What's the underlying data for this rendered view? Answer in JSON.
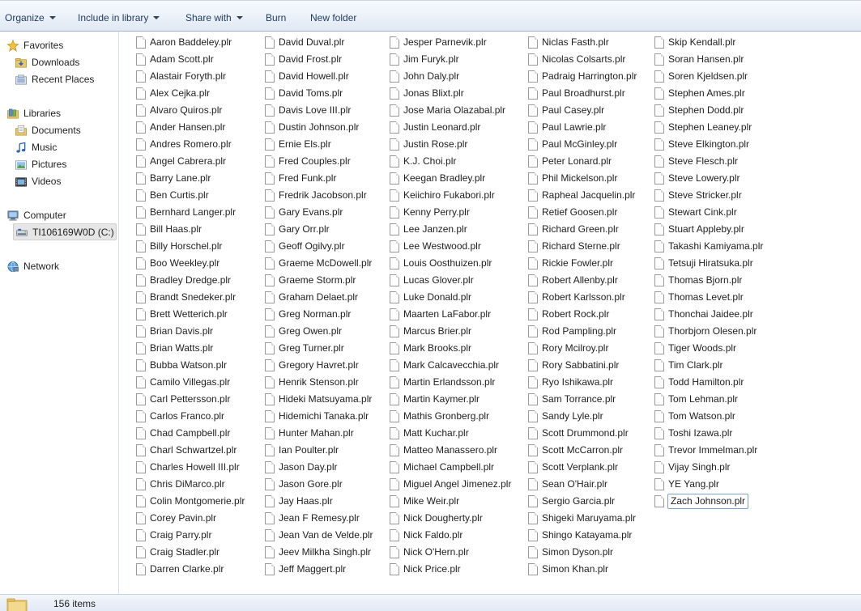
{
  "toolbar": {
    "organize": "Organize",
    "include_in_library": "Include in library",
    "share_with": "Share with",
    "burn": "Burn",
    "new_folder": "New folder"
  },
  "nav": {
    "favorites": "Favorites",
    "downloads": "Downloads",
    "recent_places": "Recent Places",
    "libraries": "Libraries",
    "documents": "Documents",
    "music": "Music",
    "pictures": "Pictures",
    "videos": "Videos",
    "computer": "Computer",
    "drive": "TI106169W0D (C:)",
    "network": "Network"
  },
  "files": {
    "columns": [
      [
        "Aaron Baddeley.plr",
        "Adam Scott.plr",
        "Alastair Foryth.plr",
        "Alex Cejka.plr",
        "Alvaro Quiros.plr",
        "Ander Hansen.plr",
        "Andres Romero.plr",
        "Angel Cabrera.plr",
        "Barry Lane.plr",
        "Ben Curtis.plr",
        "Bernhard Langer.plr",
        "Bill Haas.plr",
        "Billy Horschel.plr",
        "Boo Weekley.plr",
        "Bradley Dredge.plr",
        "Brandt Snedeker.plr",
        "Brett Wetterich.plr",
        "Brian Davis.plr",
        "Brian Watts.plr",
        "Bubba Watson.plr",
        "Camilo Villegas.plr",
        "Carl Pettersson.plr",
        "Carlos Franco.plr",
        "Chad Campbell.plr",
        "Charl Schwartzel.plr",
        "Charles Howell III.plr",
        "Chris DiMarco.plr",
        "Colin Montgomerie.plr",
        "Corey Pavin.plr",
        "Craig Parry.plr",
        "Craig Stadler.plr",
        "Darren Clarke.plr"
      ],
      [
        "David Duval.plr",
        "David Frost.plr",
        "David Howell.plr",
        "David Toms.plr",
        "Davis Love III.plr",
        "Dustin Johnson.plr",
        "Ernie Els.plr",
        "Fred Couples.plr",
        "Fred Funk.plr",
        "Fredrik Jacobson.plr",
        "Gary Evans.plr",
        "Gary Orr.plr",
        "Geoff Ogilvy.plr",
        "Graeme McDowell.plr",
        "Graeme Storm.plr",
        "Graham Delaet.plr",
        "Greg Norman.plr",
        "Greg Owen.plr",
        "Greg Turner.plr",
        "Gregory Havret.plr",
        "Henrik Stenson.plr",
        "Hideki Matsuyama.plr",
        "Hidemichi Tanaka.plr",
        "Hunter Mahan.plr",
        "Ian Poulter.plr",
        "Jason  Day.plr",
        "Jason Gore.plr",
        "Jay Haas.plr",
        "Jean F Remesy.plr",
        "Jean Van de Velde.plr",
        "Jeev Milkha Singh.plr",
        "Jeff Maggert.plr"
      ],
      [
        "Jesper Parnevik.plr",
        "Jim Furyk.plr",
        "John Daly.plr",
        "Jonas Blixt.plr",
        "Jose Maria Olazabal.plr",
        "Justin Leonard.plr",
        "Justin Rose.plr",
        "K.J. Choi.plr",
        "Keegan Bradley.plr",
        "Keiichiro Fukabori.plr",
        "Kenny Perry.plr",
        "Lee Janzen.plr",
        "Lee Westwood.plr",
        "Louis Oosthuizen.plr",
        "Lucas Glover.plr",
        "Luke Donald.plr",
        "Maarten LaFabor.plr",
        "Marcus Brier.plr",
        "Mark Brooks.plr",
        "Mark Calcavecchia.plr",
        "Martin Erlandsson.plr",
        "Martin Kaymer.plr",
        "Mathis Gronberg.plr",
        "Matt Kuchar.plr",
        "Matteo Manassero.plr",
        "Michael Campbell.plr",
        "Miguel Angel Jimenez.plr",
        "Mike Weir.plr",
        "Nick Dougherty.plr",
        "Nick Faldo.plr",
        "Nick O'Hern.plr",
        "Nick Price.plr"
      ],
      [
        "Niclas Fasth.plr",
        "Nicolas Colsarts.plr",
        "Padraig Harrington.plr",
        "Paul Broadhurst.plr",
        "Paul Casey.plr",
        "Paul Lawrie.plr",
        "Paul McGinley.plr",
        "Peter Lonard.plr",
        "Phil Mickelson.plr",
        "Rapheal Jacquelin.plr",
        "Retief Goosen.plr",
        "Richard Green.plr",
        "Richard Sterne.plr",
        "Rickie Fowler.plr",
        "Robert Allenby.plr",
        "Robert Karlsson.plr",
        "Robert Rock.plr",
        "Rod Pampling.plr",
        "Rory Mcilroy.plr",
        "Rory Sabbatini.plr",
        "Ryo Ishikawa.plr",
        "Sam Torrance.plr",
        "Sandy Lyle.plr",
        "Scott Drummond.plr",
        "Scott McCarron.plr",
        "Scott Verplank.plr",
        "Sean O'Hair.plr",
        "Sergio Garcia.plr",
        "Shigeki Maruyama.plr",
        "Shingo Katayama.plr",
        "Simon Dyson.plr",
        "Simon Khan.plr"
      ],
      [
        "Skip Kendall.plr",
        "Soran Hansen.plr",
        "Soren Kjeldsen.plr",
        "Stephen Ames.plr",
        "Stephen Dodd.plr",
        "Stephen Leaney.plr",
        "Steve Elkington.plr",
        "Steve Flesch.plr",
        "Steve Lowery.plr",
        "Steve Stricker.plr",
        "Stewart Cink.plr",
        "Stuart Appleby.plr",
        "Takashi Kamiyama.plr",
        "Tetsuji Hiratsuka.plr",
        "Thomas Bjorn.plr",
        "Thomas Levet.plr",
        "Thonchai Jaidee.plr",
        "Thorbjorn Olesen.plr",
        "Tiger Woods.plr",
        "Tim Clark.plr",
        "Todd Hamilton.plr",
        "Tom Lehman.plr",
        "Tom Watson.plr",
        "Toshi Izawa.plr",
        "Trevor Immelman.plr",
        "Vijay Singh.plr",
        "YE Yang.plr",
        "Zach Johnson.plr"
      ]
    ],
    "selected": "Zach Johnson.plr"
  },
  "status": {
    "item_count": "156 items"
  },
  "colors": {
    "toolbar_text": "#1e395b",
    "selection_border": "#7da2ce"
  }
}
